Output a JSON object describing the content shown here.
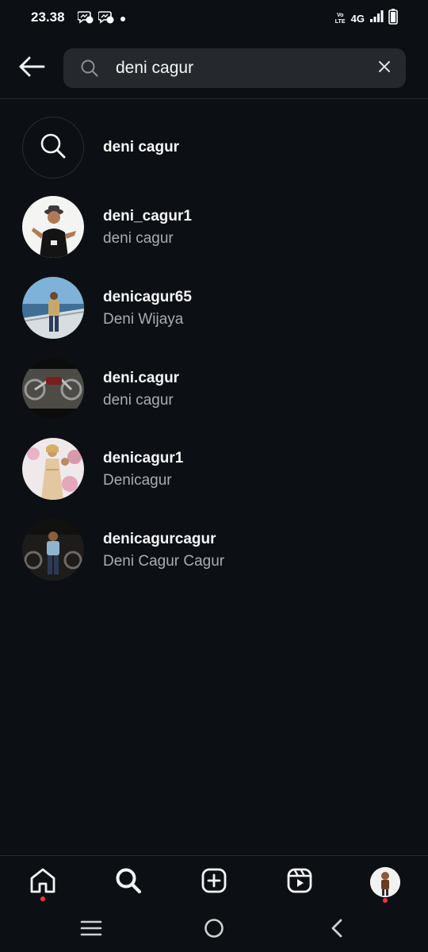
{
  "status_bar": {
    "time": "23.38",
    "volte_top": "Vo",
    "volte_bottom": "LTE",
    "network": "4G",
    "icons": [
      "messenger-notification-icon",
      "messenger-notification-icon",
      "dot-icon",
      "signal-icon",
      "battery-icon"
    ]
  },
  "search": {
    "query": "deni cagur",
    "icons": {
      "back": "arrow-left-icon",
      "search": "search-icon",
      "clear": "close-icon"
    }
  },
  "query_suggestion": {
    "text": "deni cagur",
    "icon": "search-icon"
  },
  "results": [
    {
      "username": "deni_cagur1",
      "full_name": "deni cagur"
    },
    {
      "username": "denicagur65",
      "full_name": "Deni Wijaya"
    },
    {
      "username": "deni.cagur",
      "full_name": "deni cagur"
    },
    {
      "username": "denicagur1",
      "full_name": "Denicagur"
    },
    {
      "username": "denicagurcagur",
      "full_name": "Deni Cagur Cagur"
    }
  ],
  "bottom_nav": {
    "items": [
      "home-icon",
      "search-icon",
      "create-icon",
      "reels-icon",
      "profile-avatar"
    ],
    "notification_dot_color": "#ff3040"
  },
  "system_nav": {
    "items": [
      "recents-icon",
      "home-circle-icon",
      "back-chevron-icon"
    ]
  },
  "colors": {
    "background": "#0c1014",
    "search_field": "#25292e",
    "primary_text": "#f5f5f5",
    "secondary_text": "#a8adb2"
  }
}
